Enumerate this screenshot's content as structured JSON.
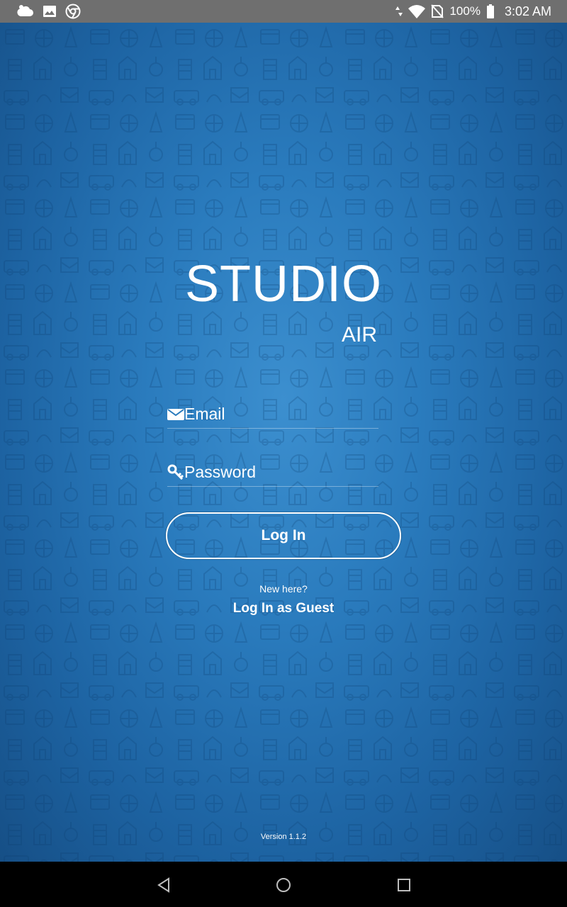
{
  "status_bar": {
    "battery_text": "100%",
    "time": "3:02 AM",
    "left_icons": [
      "cloud-icon",
      "image-icon",
      "chrome-icon"
    ],
    "right_icons": [
      "data-arrows-icon",
      "wifi-icon",
      "no-sim-icon",
      "battery-icon"
    ]
  },
  "app": {
    "title": "STUDIO",
    "subtitle": "AIR",
    "email": {
      "placeholder": "Email",
      "value": "",
      "icon": "envelope-icon"
    },
    "password": {
      "placeholder": "Password",
      "value": "",
      "icon": "key-icon"
    },
    "login_label": "Log In",
    "new_here": "New here?",
    "guest_label": "Log In as Guest",
    "version": "Version 1.1.2"
  },
  "nav_bar": {
    "icons": [
      "back-icon",
      "home-icon",
      "recents-icon"
    ]
  },
  "colors": {
    "background_center": "#3c8fcf",
    "background_edge": "#164f86",
    "status_bar": "#6f6f6f",
    "nav_bar": "#000000",
    "text": "#ffffff"
  }
}
